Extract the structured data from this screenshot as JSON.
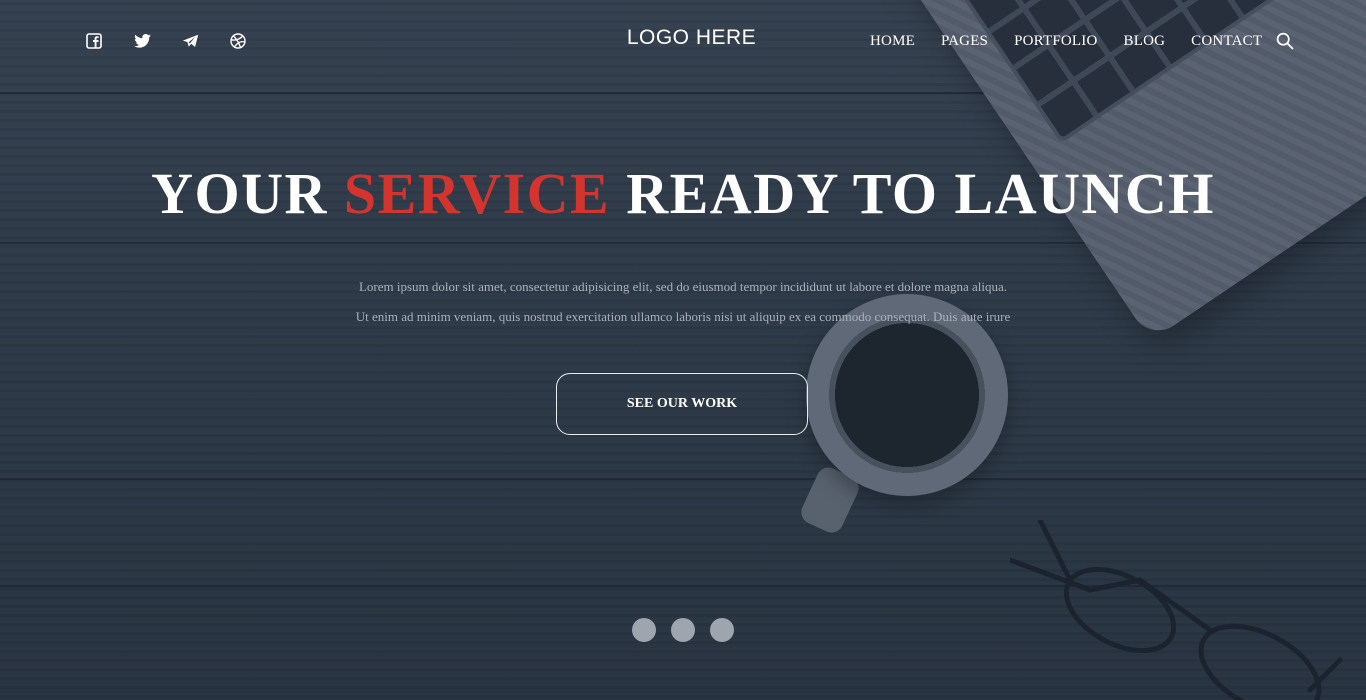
{
  "header": {
    "social": [
      {
        "icon": "facebook-icon"
      },
      {
        "icon": "twitter-icon"
      },
      {
        "icon": "telegram-icon"
      },
      {
        "icon": "dribbble-icon"
      }
    ],
    "logo": "LOGO HERE",
    "nav": [
      "HOME",
      "PAGES",
      "PORTFOLIO",
      "BLOG",
      "CONTACT"
    ],
    "search_icon": "search-icon"
  },
  "hero": {
    "title_part1": "YOUR",
    "title_accent": "SERVICE",
    "title_part2": "READY TO LAUNCH",
    "line1": "Lorem ipsum dolor sit amet, consectetur adipisicing elit, sed do eiusmod tempor incididunt ut labore et dolore magna aliqua.",
    "line2": "Ut enim ad minim veniam, quis nostrud exercitation ullamco laboris nisi ut aliquip ex ea commodo consequat. Duis aute irure",
    "cta": "SEE OUR WORK"
  },
  "slider": {
    "slide_count": 3
  },
  "colors": {
    "accent": "#d3352e",
    "text": "#ffffff",
    "muted": "#a9b0ba",
    "dot": "#9ea5ae"
  }
}
